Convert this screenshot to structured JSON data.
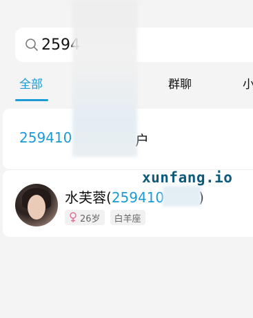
{
  "search": {
    "query": "2594",
    "placeholder": ""
  },
  "tabs": [
    {
      "label": "全部",
      "active": true
    },
    {
      "label": "群聊",
      "active": false
    },
    {
      "label": "小",
      "active": false
    }
  ],
  "results": {
    "uid_prefix": "259410",
    "uid_trailing": "户",
    "contact": {
      "name": "水芙蓉",
      "open_paren": "(",
      "id": "259410",
      "close_paren": ")",
      "age": "26岁",
      "zodiac": "白羊座"
    }
  },
  "watermark": "xunfang.io",
  "colors": {
    "accent": "#1b9ad8",
    "background": "#f4f4f4",
    "female": "#e26d9e"
  }
}
